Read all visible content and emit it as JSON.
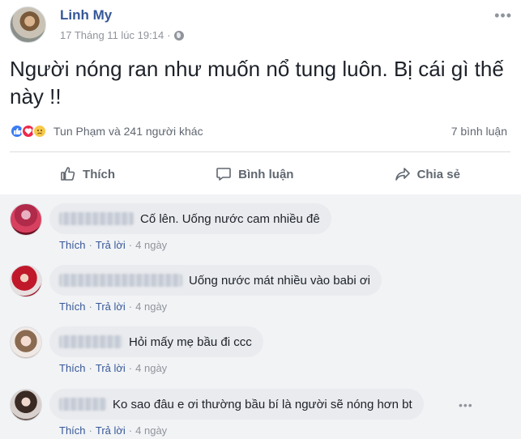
{
  "post": {
    "author": "Linh My",
    "timestamp": "17 Tháng 11 lúc 19:14",
    "separator": "·",
    "privacy_icon": "globe-icon",
    "text": "Người nóng ran như muốn nổ tung luôn. Bị cái gì thế này !!"
  },
  "reactions": {
    "icons": [
      "like-icon",
      "love-icon",
      "sad-icon"
    ],
    "summary": "Tun Phạm và 241 người khác",
    "comment_count": "7 bình luận"
  },
  "actions": {
    "like": "Thích",
    "comment": "Bình luận",
    "share": "Chia sẻ"
  },
  "comments": [
    {
      "text": "Cố lên. Uống nước cam nhiều đê",
      "like": "Thích",
      "reply": "Trả lời",
      "age": "4 ngày"
    },
    {
      "text": "Uống nước mát nhiều vào babi ơi",
      "like": "Thích",
      "reply": "Trả lời",
      "age": "4 ngày"
    },
    {
      "text": "Hỏi mấy mẹ bầu đi ccc",
      "like": "Thích",
      "reply": "Trả lời",
      "age": "4 ngày"
    },
    {
      "text": "Ko sao đâu e ơi thường bầu bí là người sẽ nóng hơn bt",
      "like": "Thích",
      "reply": "Trả lời",
      "age": "4 ngày"
    }
  ],
  "dot": "·",
  "colors": {
    "link": "#365899",
    "muted": "#90949c",
    "like": "#3b7cf5",
    "love": "#f0284a",
    "sad": "#f7c84a"
  }
}
